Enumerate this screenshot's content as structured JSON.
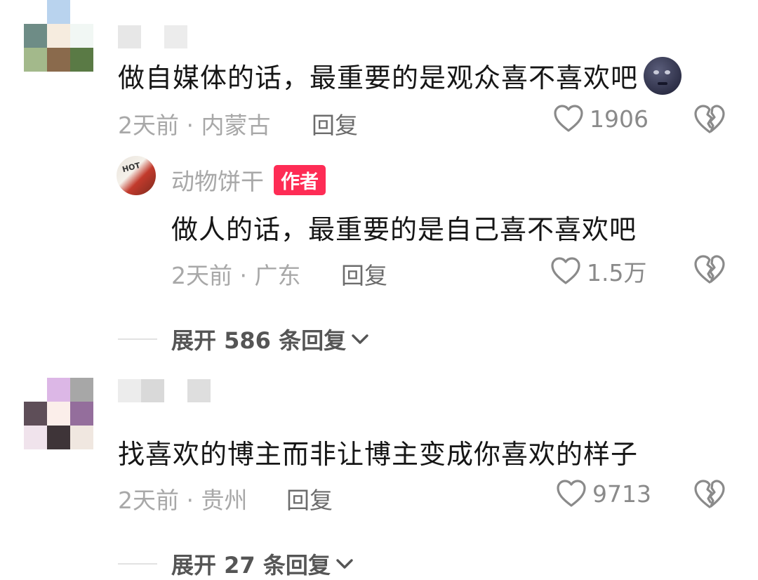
{
  "comments": [
    {
      "text": "做自媒体的话，最重要的是观众喜不喜欢吧",
      "emoji": "new-moon-face-emoji",
      "meta": "2天前 · 内蒙古",
      "reply_label": "回复",
      "likes": "1906",
      "avatar_colors": [
        "#ffffff",
        "#b9d3ee",
        "#ffffff",
        "#6e8c86",
        "#f6ecdf",
        "#f1f7f4",
        "#a3b98b",
        "#8a6a4c",
        "#5a7a45"
      ],
      "name_blur_colors": [
        "#e7e7e7",
        "#ffffff",
        "#ececec"
      ],
      "replies": [
        {
          "author": "动物饼干",
          "badge": "作者",
          "avatar_text": "HOT",
          "text": "做人的话，最重要的是自己喜不喜欢吧",
          "meta": "2天前 · 广东",
          "reply_label": "回复",
          "likes": "1.5万"
        }
      ],
      "expand_label": "展开 586 条回复"
    },
    {
      "text": "找喜欢的博主而非让博主变成你喜欢的样子",
      "meta": "2天前 · 贵州",
      "reply_label": "回复",
      "likes": "9713",
      "avatar_colors": [
        "#ffffff",
        "#dcb7e6",
        "#a7a7a7",
        "#5e4e58",
        "#fbeeea",
        "#946e9c",
        "#f0e3ec",
        "#3e3438",
        "#f0e7e0"
      ],
      "name_blur_colors": [
        "#ececec",
        "#d9d9d9",
        "#ffffff",
        "#dedede"
      ],
      "expand_label": "展开 27 条回复"
    }
  ],
  "icons": {
    "like": "heart-outline-icon",
    "dislike": "broken-heart-icon",
    "expand": "chevron-down-icon"
  },
  "colors": {
    "badge": "#fe2c55",
    "meta": "#a8a8a8"
  }
}
